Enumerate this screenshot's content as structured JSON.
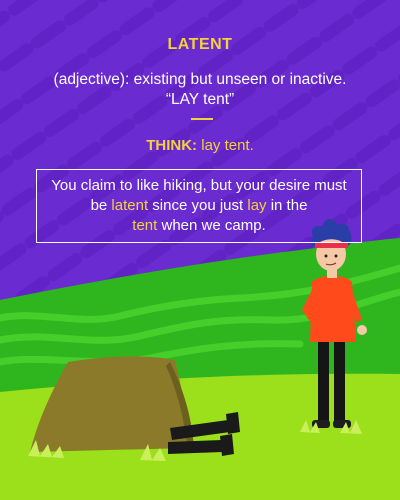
{
  "word": "LATENT",
  "definition_line1": "(adjective): existing but unseen or inactive.",
  "definition_line2": "“LAY tent”",
  "think_keyword": "THINK:",
  "think_phrase": "lay tent.",
  "example": {
    "part1": "You claim to like hiking, but your desire must be",
    "highlight1": "latent",
    "part2": "since you just",
    "highlight2": "lay",
    "part3": "in the",
    "highlight3": "tent",
    "part4": "when we camp."
  },
  "colors": {
    "background": "#6a2bd0",
    "accent": "#f4d23b",
    "hill_green": "#2fb51e",
    "grass": "#9be01a",
    "tent": "#8a7a2a",
    "shirt": "#ff4a1c"
  }
}
